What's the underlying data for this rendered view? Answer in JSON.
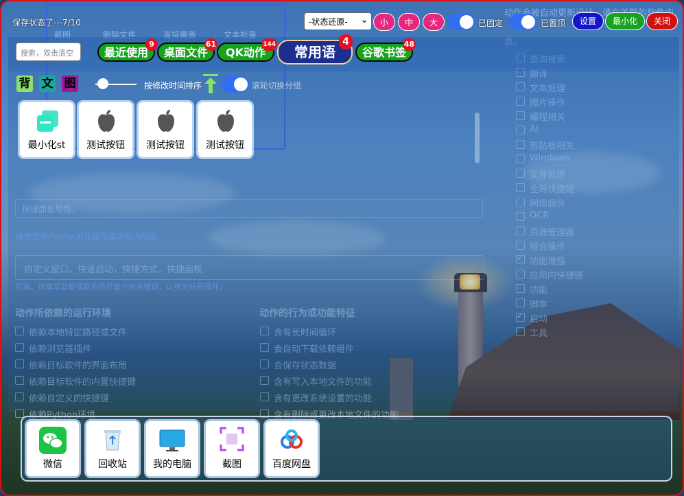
{
  "status": "保存状态了---7/10",
  "state_select": "-状态还原-",
  "sizes": [
    "小",
    "中",
    "大"
  ],
  "pin_label": "已固定",
  "top_label": "已置顶",
  "settings_label": "设置",
  "minimize_label": "最小化",
  "close_label": "关闭",
  "colors": {
    "green": "#16a31e",
    "navy": "#1c2f8f",
    "pink": "#e6277e",
    "red": "#e8101e",
    "blue": "#2f6ff0"
  },
  "search_placeholder": "搜索，双击清空",
  "tabs": [
    {
      "label": "最近使用",
      "badge": "9"
    },
    {
      "label": "桌面文件",
      "badge": "61"
    },
    {
      "label": "QK动作",
      "badge": "144"
    },
    {
      "label": "常用语",
      "badge": "4"
    },
    {
      "label": "谷歌书签",
      "badge": "48"
    }
  ],
  "modes": [
    "背",
    "文",
    "图"
  ],
  "sort_label": "按修改时间排序",
  "group_label": "滚轮切换分组",
  "cards": [
    {
      "label": "最小化st",
      "icon": "stack-icon"
    },
    {
      "label": "测试按钮",
      "icon": "apple-icon"
    },
    {
      "label": "测试按钮",
      "icon": "apple-icon"
    },
    {
      "label": "测试按钮",
      "icon": "apple-icon"
    }
  ],
  "dock": [
    {
      "label": "微信",
      "icon": "wechat-icon"
    },
    {
      "label": "回收站",
      "icon": "recycle-bin-icon"
    },
    {
      "label": "我的电脑",
      "icon": "monitor-icon"
    },
    {
      "label": "截图",
      "icon": "screenshot-icon"
    },
    {
      "label": "百度网盘",
      "icon": "cloud-drive-icon"
    }
  ],
  "bg_window": {
    "toolbar": [
      "截图",
      "删除文件",
      "直接覆盖",
      "文本批量"
    ],
    "header_right": "动作会被自动更新设计，请在关联的软件中",
    "header_right2": "息。",
    "desc_placeholder": "快捷面板增强，",
    "firefox_note": "请勿使用Firefox浏览器在编辑框内贴图。",
    "keywords_placeholder": "自定义窗口，快速启动，快捷方式，快捷面板",
    "keywords_hint": "可选。仅填写具有强联系的尽量少的关键词，以英文分号隔开。",
    "env_title": "动作所依赖的运行环境",
    "env_items": [
      "依赖本地特定路径或文件",
      "依赖浏览器插件",
      "依赖目标软件的界面布局",
      "依赖目标软件的内置快捷键",
      "依赖自定义的快捷键",
      "依赖Python环境"
    ],
    "feat_title": "动作的行为或功能特征",
    "feat_items": [
      "含有长时间循环",
      "会自动下载依赖组件",
      "会保存状态数据",
      "含有写入本地文件的功能",
      "含有更改系统设置的功能",
      "含有删除或更改本地文件的功能"
    ],
    "categories": [
      "查询搜索",
      "翻译",
      "文本处理",
      "图片操作",
      "编程相关",
      "AI",
      "剪贴板相关",
      "Windows",
      "文件处理",
      "全局快捷键",
      "网络服务",
      "OCR",
      "资源管理器",
      "组合操作",
      "功能增强",
      "应用内快捷键",
      "功能",
      "脚本",
      "启动",
      "工具"
    ],
    "checked": [
      14,
      18
    ]
  }
}
